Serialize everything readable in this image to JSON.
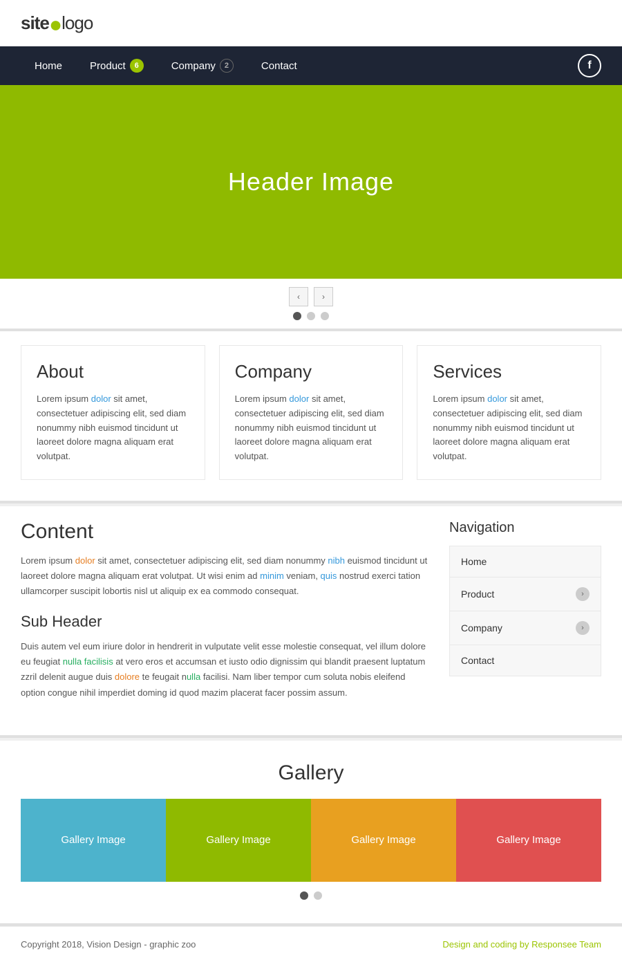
{
  "header": {
    "logo_site": "site",
    "logo_name": "logo",
    "logo_dot": "●"
  },
  "nav": {
    "items": [
      {
        "label": "Home",
        "badge": null
      },
      {
        "label": "Product",
        "badge": "6",
        "badge_type": "green"
      },
      {
        "label": "Company",
        "badge": "2",
        "badge_type": "outline"
      },
      {
        "label": "Contact",
        "badge": null
      }
    ],
    "facebook_label": "f"
  },
  "hero": {
    "text": "Header Image"
  },
  "slider": {
    "prev": "‹",
    "next": "›",
    "dots": [
      true,
      false,
      false
    ]
  },
  "cards": [
    {
      "title": "About",
      "text": "Lorem ipsum dolor sit amet, consectetuer adipiscing elit, sed diam nonummy nibh euismod tincidunt ut laoreet dolore magna aliquam erat volutpat."
    },
    {
      "title": "Company",
      "text": "Lorem ipsum dolor sit amet, consectetuer adipiscing elit, sed diam nonummy nibh euismod tincidunt ut laoreet dolore magna aliquam erat volutpat."
    },
    {
      "title": "Services",
      "text": "Lorem ipsum dolor sit amet, consectetuer adipiscing elit, sed diam nonummy nibh euismod tincidunt ut laoreet dolore magna aliquam erat volutpat."
    }
  ],
  "content": {
    "title": "Content",
    "text": "Lorem ipsum dolor sit amet, consectetuer adipiscing elit, sed diam nonummy nibh euismod tincidunt ut laoreet dolore magna aliquam erat volutpat. Ut wisi enim ad minim veniam, quis nostrud exerci tation ullamcorper suscipit lobortis nisl ut aliquip ex ea commodo consequat.",
    "sub_header": "Sub Header",
    "sub_text": "Duis autem vel eum iriure dolor in hendrerit in vulputate velit esse molestie consequat, vel illum dolore eu feugiat nulla facilisis at vero eros et accumsan et iusto odio dignissim qui blandit praesent luptatum zzril delenit augue duis dolore te feugait nulla facilisi. Nam liber tempor cum soluta nobis eleifend option congue nihil imperdiet doming id quod mazim placerat facer possim assum."
  },
  "sidebar": {
    "title": "Navigation",
    "items": [
      {
        "label": "Home",
        "arrow": false
      },
      {
        "label": "Product",
        "arrow": true
      },
      {
        "label": "Company",
        "arrow": true
      },
      {
        "label": "Contact",
        "arrow": false
      }
    ]
  },
  "gallery": {
    "title": "Gallery",
    "items": [
      {
        "label": "Gallery Image",
        "color": "blue"
      },
      {
        "label": "Gallery Image",
        "color": "green"
      },
      {
        "label": "Gallery Image",
        "color": "yellow"
      },
      {
        "label": "Gallery Image",
        "color": "red"
      }
    ],
    "dots": [
      true,
      false
    ]
  },
  "footer": {
    "copyright": "Copyright 2018, Vision Design - graphic zoo",
    "credit": "Design and coding by Responsee Team"
  }
}
